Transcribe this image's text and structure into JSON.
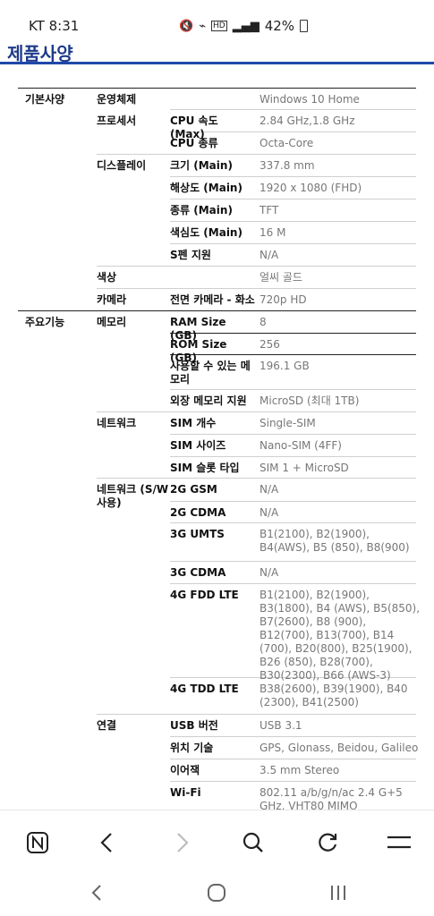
{
  "status_bar": {
    "time": "KT 8:31",
    "signal_text": "HD",
    "battery": "42%"
  },
  "page": {
    "title": "제품사양"
  },
  "spec_rows": [
    {
      "c1": "기본사양",
      "c2": "운영체제",
      "c3": "",
      "value": "Windows 10 Home"
    },
    {
      "c1": "",
      "c2": "프로세서",
      "c3": "CPU 속도 (Max)",
      "value": "2.84 GHz,1.8 GHz"
    },
    {
      "c1": "",
      "c2": "",
      "c3": "CPU 종류",
      "value": "Octa-Core"
    },
    {
      "c1": "",
      "c2": "디스플레이",
      "c3": "크기 (Main)",
      "value": "337.8 mm"
    },
    {
      "c1": "",
      "c2": "",
      "c3": "해상도 (Main)",
      "value": "1920 x 1080 (FHD)"
    },
    {
      "c1": "",
      "c2": "",
      "c3": "종류 (Main)",
      "value": "TFT"
    },
    {
      "c1": "",
      "c2": "",
      "c3": "색심도 (Main)",
      "value": "16 M"
    },
    {
      "c1": "",
      "c2": "",
      "c3": "S펜 지원",
      "value": "N/A"
    },
    {
      "c1": "",
      "c2": "색상",
      "c3": "",
      "value": "얼씨 골드"
    },
    {
      "c1": "",
      "c2": "카메라",
      "c3": "전면 카메라 - 화소",
      "value": "720p HD"
    },
    {
      "c1": "주요기능",
      "c2": "메모리",
      "c3": "RAM Size (GB)",
      "value": "8"
    },
    {
      "c1": "",
      "c2": "",
      "c3": "ROM Size (GB)",
      "value": "256"
    },
    {
      "c1": "",
      "c2": "",
      "c3": "사용할 수 있는 메모리",
      "value": "196.1 GB"
    },
    {
      "c1": "",
      "c2": "",
      "c3": "외장 메모리 지원",
      "value": "MicroSD (최대 1TB)"
    },
    {
      "c1": "",
      "c2": "네트워크",
      "c3": "SIM 개수",
      "value": "Single-SIM"
    },
    {
      "c1": "",
      "c2": "",
      "c3": "SIM 사이즈",
      "value": "Nano-SIM (4FF)"
    },
    {
      "c1": "",
      "c2": "",
      "c3": "SIM 슬롯 타입",
      "value": "SIM 1 + MicroSD"
    },
    {
      "c1": "",
      "c2": "네트워크 (S/W 사용)",
      "c3": "2G GSM",
      "value": "N/A"
    },
    {
      "c1": "",
      "c2": "",
      "c3": "2G CDMA",
      "value": "N/A"
    },
    {
      "c1": "",
      "c2": "",
      "c3": "3G UMTS",
      "value": "B1(2100), B2(1900), B4(AWS), B5 (850), B8(900)"
    },
    {
      "c1": "",
      "c2": "",
      "c3": "3G CDMA",
      "value": "N/A"
    },
    {
      "c1": "",
      "c2": "",
      "c3": "4G FDD LTE",
      "value": "B1(2100), B2(1900), B3(1800), B4 (AWS), B5(850), B7(2600), B8 (900), B12(700), B13(700), B14 (700), B20(800), B25(1900), B26 (850), B28(700), B30(2300), B66 (AWS-3)"
    },
    {
      "c1": "",
      "c2": "",
      "c3": "4G TDD LTE",
      "value": "B38(2600), B39(1900), B40 (2300), B41(2500)"
    },
    {
      "c1": "",
      "c2": "연결",
      "c3": "USB 버전",
      "value": "USB 3.1"
    },
    {
      "c1": "",
      "c2": "",
      "c3": "위치 기술",
      "value": "GPS, Glonass, Beidou, Galileo"
    },
    {
      "c1": "",
      "c2": "",
      "c3": "이어잭",
      "value": "3.5 mm Stereo"
    },
    {
      "c1": "",
      "c2": "",
      "c3": "Wi-Fi",
      "value": "802.11 a/b/g/n/ac 2.4 G+5 GHz, VHT80 MIMO"
    }
  ],
  "toolbar": {
    "icons": [
      "app-n-icon",
      "back-icon",
      "forward-icon",
      "search-icon",
      "reload-icon",
      "menu-icon"
    ]
  },
  "system_nav": {
    "icons": [
      "recents-back-icon",
      "home-icon",
      "recents-icon"
    ]
  }
}
